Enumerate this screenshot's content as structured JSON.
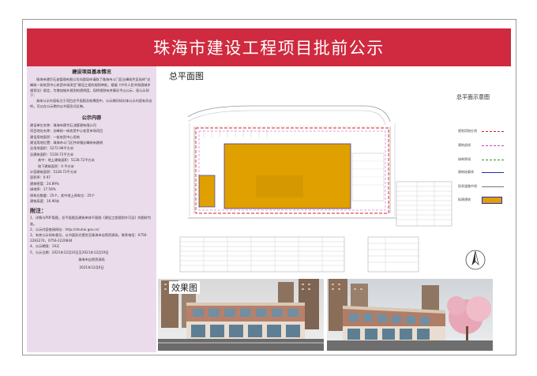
{
  "banner": {
    "title": "珠海市建设工程项目批前公示"
  },
  "left": {
    "basic_heading": "建设项目基本情况",
    "basic_para1": "珠海市建华石油管理有限公司向我局申请取了珠海市斗门区尖峰前片区桂岭\"尖峰前一街农贸中心农贸市场项目\"建设工程的规划审批，根据《中华人民共和国城乡规划法》规定，为增加城乡规划的透明度，现将规划有关情况予以公示，现公示如下：",
    "basic_para2": "具体公示内容标注于项目总平面图及效果图中，公示期间如对本公示内容有异议的，可以在公示期内以书面形式反映。",
    "content_heading": "公示内容",
    "fields": [
      "建设单位名称：珠海市建华石油管理有限公司",
      "项目地址名称：尖峰前一街农贸中心农贸市场项目",
      "建设用地面积：一街农贸中心用地",
      "建设用地位置：珠海市斗门区井岸镇尖峰前有路侧",
      "总用地面积：5272.98平方米",
      "总建筑面积：5128.72平方米",
      "其中：地上建筑面积：5128.72平方米",
      "地下建筑面积：0 平方米",
      "计容建筑面积：5128.72平方米",
      "容积率：0.97",
      "建筑密度：24.89%",
      "绿地率：17.58%",
      "停车位数量：25个，其中地上停车位：25个",
      "建筑高度：16.90米"
    ],
    "notes_heading": "附注：",
    "notes": [
      "1、详情与PDF版图，总平面图及建筑单体平面图《建设工程规划许可证》的图样为准。",
      "2、公示内容查阅网址：http://zhuhai.gov.cn/",
      "3、有关公示如有意见，以书面形式提交至珠海市自然资源局，联系电话：0756-2283274，0756-2220844",
      "4、公示期限：10天",
      "5、公示日期：2021年12月10日至2021年12月19日"
    ],
    "issuer": "珠海市自然资源局",
    "issue_date": "2021年12月6日"
  },
  "siteplan": {
    "title": "总平面图",
    "legend_title": "总平面示意图",
    "legend": [
      {
        "label": "规划用地红线",
        "color": "#d62020",
        "style": "dashed"
      },
      {
        "label": "建筑退线",
        "color": "#c040c0",
        "style": "dashed"
      },
      {
        "label": "绿带界线",
        "color": "#2a9a2a",
        "style": "dashed"
      },
      {
        "label": "建筑轮廓线",
        "color": "#2a2ab0",
        "style": "solid"
      },
      {
        "label": "现状道路中线",
        "color": "#777777",
        "style": "solid"
      },
      {
        "label": "拟建建筑",
        "color": "#e0a000",
        "style": "fill"
      }
    ]
  },
  "renders": {
    "title": "效果图"
  }
}
